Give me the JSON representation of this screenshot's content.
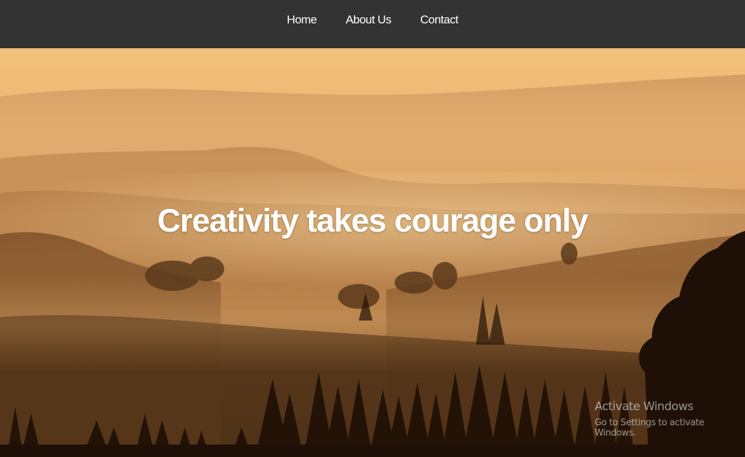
{
  "nav": {
    "items": [
      {
        "label": "Home"
      },
      {
        "label": "About Us"
      },
      {
        "label": "Contact"
      }
    ]
  },
  "hero": {
    "title": "Creativity takes courage only",
    "image": "misty-hills-sunrise-landscape"
  },
  "watermark": {
    "title": "Activate Windows",
    "subtitle": "Go to Settings to activate Windows."
  },
  "colors": {
    "navbar": "#333333",
    "nav_text": "#ffffff",
    "hero_title": "#ffffff",
    "sky_top": "#f6c67a",
    "haze": "#d9a566",
    "trees": "#241407"
  }
}
